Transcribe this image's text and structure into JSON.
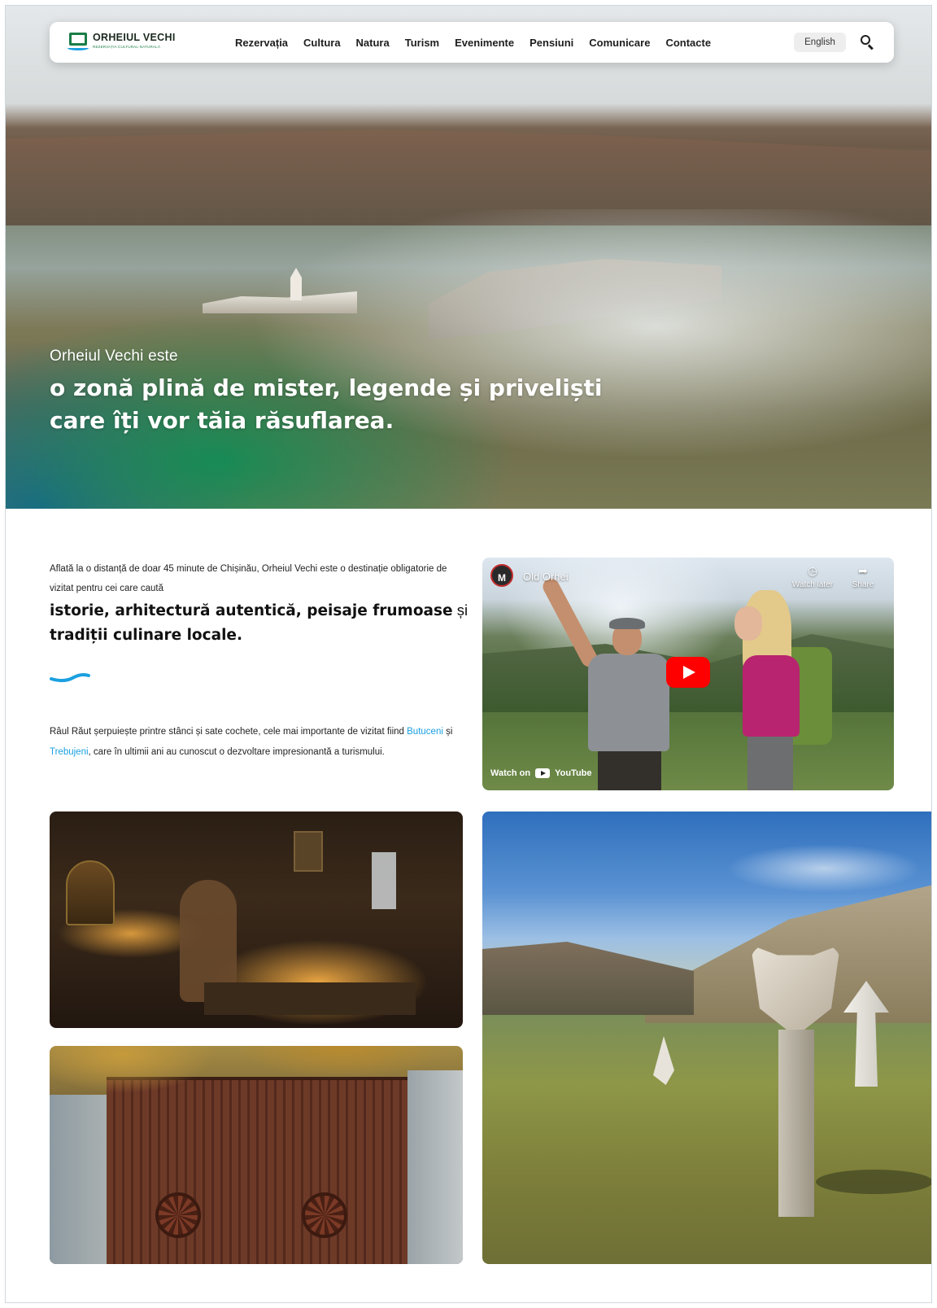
{
  "nav": {
    "logo_name": "ORHEIUL VECHI",
    "logo_sub": "REZERVAȚIA CULTURAL-NATURALĂ",
    "items": [
      "Rezervația",
      "Cultura",
      "Natura",
      "Turism",
      "Evenimente",
      "Pensiuni",
      "Comunicare",
      "Contacte"
    ],
    "language": "English",
    "search_icon": "search-icon"
  },
  "hero": {
    "line_small": "Orheiul Vechi este",
    "line_big": "o zonă plină de mister, legende și priveliști care îți vor tăia răsuflarea."
  },
  "intro": {
    "small": "Aflată la o distanță de doar 45 minute de Chișinău, Orheiul Vechi este o destinație obligatorie de vizitat pentru cei care caută",
    "big_bold_1": "istorie, arhitectură autentică, peisaje frumoase",
    "big_conj": " și ",
    "big_bold_2": "tradiții culinare locale.",
    "river_1": "Râul Răut șerpuiește printre stânci și sate cochete, cele mai importante de vizitat fiind ",
    "river_link_1": "Butuceni",
    "river_2": " și ",
    "river_link_2": "Trebujeni",
    "river_3": ", care în ultimii ani au cunoscut o dezvoltare impresionantă a turismului."
  },
  "video": {
    "channel_badge": "M",
    "title": "Old Orhei",
    "watch_later": "Watch later",
    "share": "Share",
    "watch_on": "Watch on",
    "youtube": "YouTube"
  },
  "colors": {
    "accent_blue": "#1aa0e0",
    "logo_green": "#1a7d46",
    "youtube_red": "#ff0000"
  }
}
